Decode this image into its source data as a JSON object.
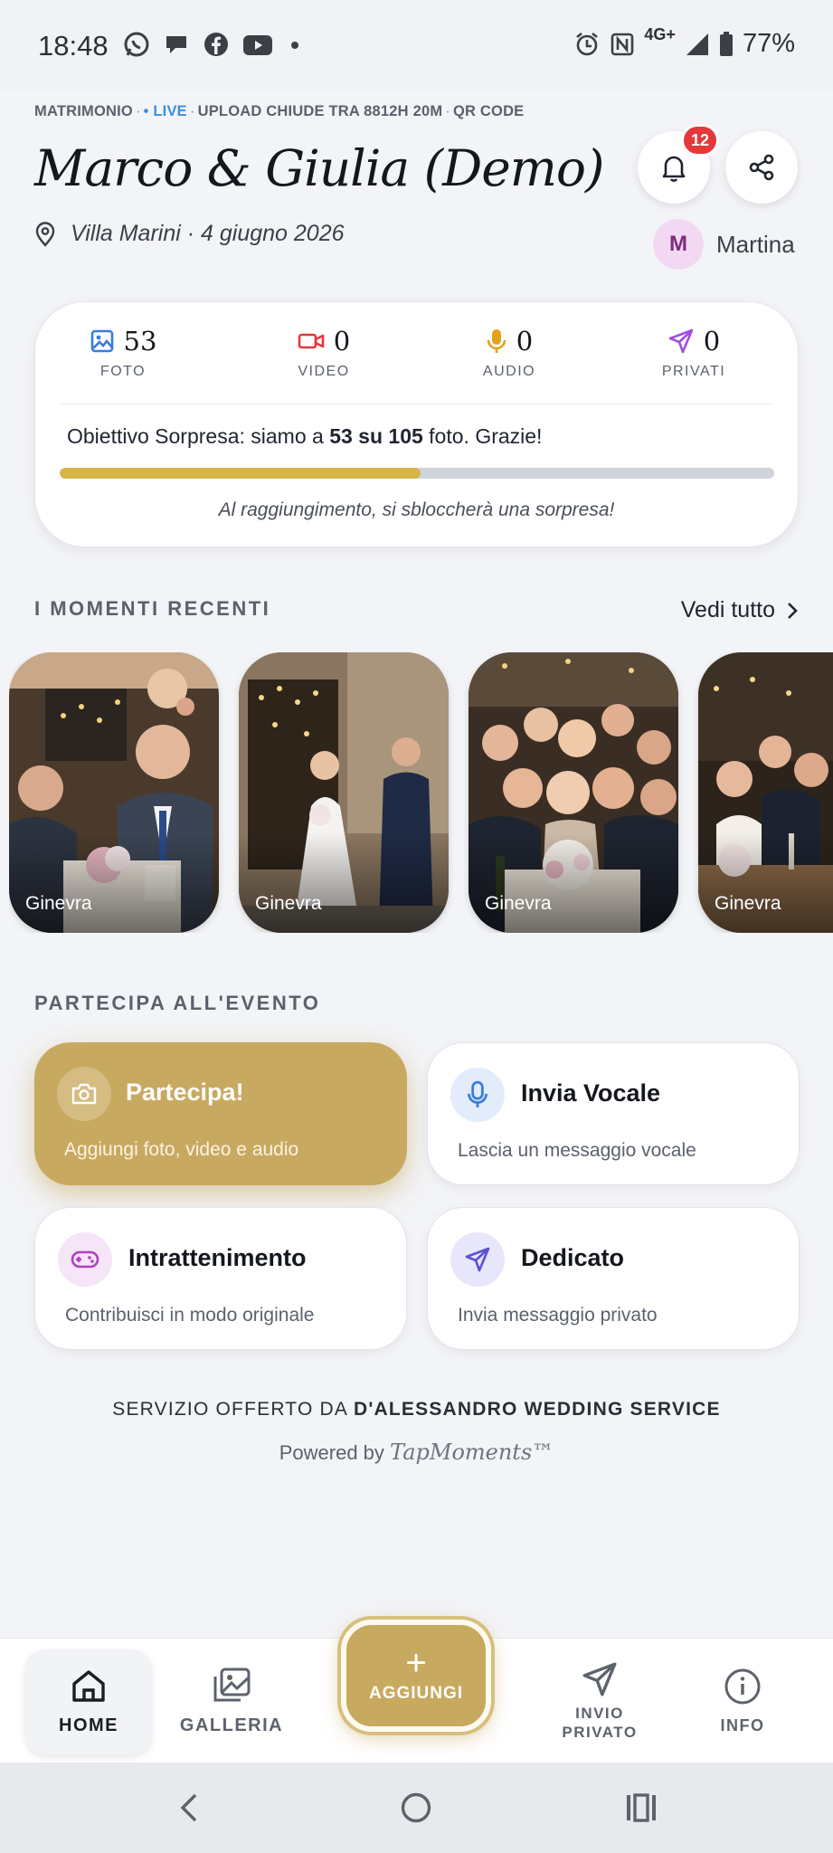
{
  "status_bar": {
    "time": "18:48",
    "network": "4G+",
    "battery": "77%",
    "app_icons": [
      "whatsapp-icon",
      "chat-icon",
      "facebook-icon",
      "youtube-icon",
      "dot-icon"
    ]
  },
  "event": {
    "meta_type": "MATRIMONIO",
    "meta_live": "• LIVE",
    "meta_upload": "UPLOAD CHIUDE TRA 8812H 20M",
    "meta_qr": "QR CODE",
    "title": "Marco & Giulia (Demo)",
    "venue": "Villa Marini · 4 giugno 2026"
  },
  "notifications": {
    "count": "12"
  },
  "user": {
    "initial": "M",
    "name": "Martina"
  },
  "stats": [
    {
      "label": "FOTO",
      "value": "53",
      "icon": "image-icon",
      "color": "#3a7be0"
    },
    {
      "label": "VIDEO",
      "value": "0",
      "icon": "video-camera-icon",
      "color": "#e5383b"
    },
    {
      "label": "AUDIO",
      "value": "0",
      "icon": "microphone-icon",
      "color": "#e3a21a"
    },
    {
      "label": "PRIVATI",
      "value": "0",
      "icon": "paper-plane-icon",
      "color": "#a34de0"
    }
  ],
  "goal": {
    "text_before": "Obiettivo Sorpresa: siamo a",
    "current": "53",
    "text_middle": "su",
    "target": "105",
    "text_after": "foto. Grazie!",
    "progress_fraction": 0.505,
    "note": "Al raggiungimento, si sbloccherà una sorpresa!"
  },
  "moments": {
    "heading": "I MOMENTI RECENTI",
    "see_all": "Vedi tutto",
    "items": [
      {
        "author": "Ginevra"
      },
      {
        "author": "Ginevra"
      },
      {
        "author": "Ginevra"
      },
      {
        "author": "Ginevra"
      }
    ]
  },
  "participate": {
    "heading": "PARTECIPA ALL'EVENTO",
    "cards": [
      {
        "title": "Partecipa!",
        "subtitle": "Aggiungi foto, video e audio",
        "icon": "camera-icon"
      },
      {
        "title": "Invia Vocale",
        "subtitle": "Lascia un messaggio vocale",
        "icon": "microphone-icon"
      },
      {
        "title": "Intrattenimento",
        "subtitle": "Contribuisci in modo originale",
        "icon": "gamepad-icon"
      },
      {
        "title": "Dedicato",
        "subtitle": "Invia messaggio privato",
        "icon": "paper-plane-icon"
      }
    ]
  },
  "footer": {
    "service_prefix": "SERVIZIO OFFERTO DA",
    "service_name": "D'ALESSANDRO WEDDING SERVICE",
    "powered_prefix": "Powered by",
    "brand": "TapMoments™"
  },
  "bottom_nav": {
    "home": "HOME",
    "gallery": "GALLERIA",
    "add": "AGGIUNGI",
    "private": "INVIO\nPRIVATO",
    "info": "INFO"
  },
  "colors": {
    "accent_gold": "#c8a960",
    "progress_fill": "#d6b54a",
    "live": "#3b8ee0",
    "badge": "#e5383b"
  }
}
